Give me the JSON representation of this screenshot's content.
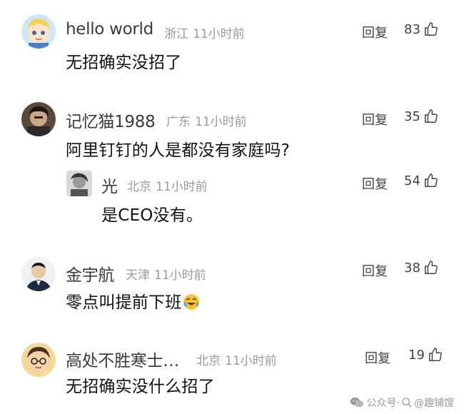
{
  "comments": [
    {
      "username": "hello world",
      "location": "浙江",
      "time": "11小时前",
      "text": "无招确实没招了",
      "reply_label": "回复",
      "likes": "83",
      "icon": "thumbs-up-icon"
    },
    {
      "username": "记忆猫1988",
      "location": "广东",
      "time": "11小时前",
      "text": "阿里钉钉的人是都没有家庭吗?",
      "reply_label": "回复",
      "likes": "35",
      "icon": "thumbs-up-icon"
    },
    {
      "username": "光",
      "location": "北京",
      "time": "11小时前",
      "text": "是CEO没有。",
      "reply_label": "回复",
      "likes": "54",
      "icon": "thumbs-up-icon"
    },
    {
      "username": "金宇航",
      "location": "天津",
      "time": "11小时前",
      "text": "零点叫提前下班",
      "reply_label": "回复",
      "likes": "38",
      "icon": "thumbs-up-icon",
      "emoji": "crying-laughing-emoji"
    },
    {
      "username": "高处不胜寒士…",
      "location": "北京",
      "time": "11小时前",
      "text": "无招确实没什么招了",
      "reply_label": "回复",
      "likes": "19",
      "icon": "thumbs-up-icon"
    }
  ],
  "watermark": {
    "text": "公众号·",
    "icon": "wechat-icon",
    "overlay_icon": "search-icon",
    "overlay_text": "@趣铺馊"
  },
  "colors": {
    "username": "#3b3b3b",
    "meta": "#9a9a9a",
    "text": "#111111",
    "background": "#ffffff"
  }
}
